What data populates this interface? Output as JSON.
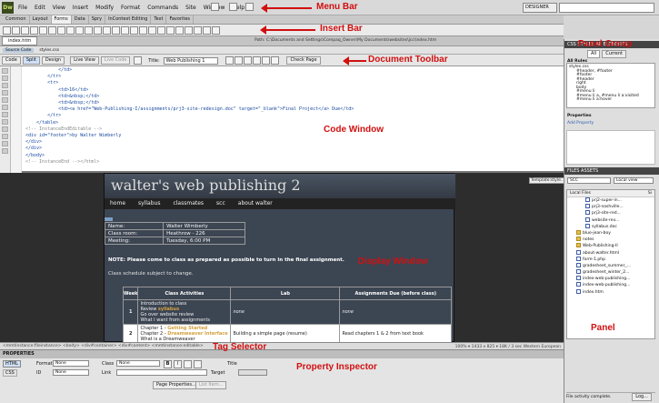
{
  "menubar": {
    "logo": "Dw",
    "items": [
      "File",
      "Edit",
      "View",
      "Insert",
      "Modify",
      "Format",
      "Commands",
      "Site",
      "Window",
      "Help"
    ],
    "workspace": "DESIGNER",
    "annotation": "Menu Bar"
  },
  "insert_bar": {
    "tabs": [
      "Common",
      "Layout",
      "Forms",
      "Data",
      "Spry",
      "InContext Editing",
      "Text",
      "Favorites"
    ],
    "active_tab": "Forms",
    "annotation": "Insert Bar"
  },
  "document": {
    "tab": "index.htm",
    "related_file": "styles.css",
    "path": "Path: C:\\Documents and Settings\\Compaq_Owner\\My Documents\\websites\\jcc\\index.htm",
    "source_code": "Source Code"
  },
  "doc_toolbar": {
    "code": "Code",
    "split": "Split",
    "design": "Design",
    "live_view": "Live View",
    "live_code": "Live Code",
    "title_label": "Title:",
    "title_value": "Web Publishing 1",
    "check_page": "Check Page",
    "annotation": "Document Toolbar"
  },
  "code_window": {
    "annotation": "Code Window",
    "lines": [
      "            </td>",
      "        </tr>",
      "        <tr>",
      "            <td>16</td>",
      "            <td>&nbsp;</td>",
      "            <td>&nbsp;</td>",
      "            <td><a href=\"Web-Publishing-I/assignments/prj3-site-redesign.doc\" target=\"_blank\">Final Project</a> Due</td>",
      "        </tr>",
      "    </table>",
      "<!-- InstanceEndEditable -->",
      "<div id=\"footer\">by Walter Wimberly",
      "</div>",
      "</div>",
      "</body>",
      "<!-- InstanceEnd --></html>"
    ]
  },
  "display_window": {
    "annotation": "Display Window",
    "site_title": "walter's web publishing 2",
    "nav": [
      "home",
      "syllabus",
      "classmates",
      "scc",
      "about walter"
    ],
    "info_rows": [
      [
        "Name:",
        "Walter Wimberly"
      ],
      [
        "Class room:",
        "Heathrow - 226"
      ],
      [
        "Meeting:",
        "Tuesday, 6:00 PM"
      ]
    ],
    "notice": "NOTE: Please come to class as prepared as possible to turn in the final assignment.",
    "subject": "Class schedule subject to change.",
    "schedule_headers": [
      "Week",
      "Class Activities",
      "Lab",
      "Assignments Due (before class)"
    ],
    "row1": {
      "week": "1",
      "activities_prefix": "Introduction to class",
      "review": "Review ",
      "review_link": "syllabus",
      "line3": "Go over website review",
      "line4": "What I want from assignments",
      "lab": "none",
      "due": "none"
    },
    "row2": {
      "week": "2",
      "ch1": "Chapter 1 - ",
      "ch1_link": "Getting Started",
      "ch2": "Chapter 2 - ",
      "ch2_link": "Dreamweaver Interface",
      "more": "What is a Dreamweaver",
      "lab": "Building a simple page (resume)",
      "due": "Read chapters 1 & 2 from text book"
    },
    "template_label": "Template:style..."
  },
  "tag_selector": {
    "annotation": "Tag Selector",
    "path": "<mmtinstance:fileinstance> <body> <div#container> <div#content> <mmtinstance:editable>",
    "status": "100% ▾  1433 x 825 ▾  18K / 3 sec  Western European"
  },
  "property_inspector": {
    "header": "PROPERTIES",
    "annotation": "Property Inspector",
    "html": "HTML",
    "css": "CSS",
    "format_label": "Format",
    "format_value": "None",
    "class_label": "Class",
    "class_value": "None",
    "id_label": "ID",
    "id_value": "None",
    "link_label": "Link",
    "title_label": "Title",
    "target_label": "Target",
    "page_props": "Page Properties...",
    "list_item": "List Item..."
  },
  "panel": {
    "annotation_group": "Panel Group",
    "annotation_panel": "Panel",
    "css_header": "CSS STYLES   AP ELEMENTS",
    "mode_all": "All",
    "mode_current": "Current",
    "all_rules": "All Rules",
    "rules": [
      "styles.css",
      "#header, #footer",
      "#footer",
      "#header",
      "right",
      "body",
      "#menu li",
      "#menu li a, #menu li a:visited",
      "#menu li a:hover"
    ],
    "properties": "Properties",
    "add_property": "Add Property",
    "files_header": "FILES   ASSETS",
    "site": "SCC",
    "view": "Local view",
    "local_files": "Local Files",
    "size_col": "Si",
    "file_rows": [
      "prj2-super-in...",
      "prj3-nashville...",
      "prj3-site-red...",
      "website-rev...",
      "syllabus.doc",
      "blue-jean-boy",
      "notes",
      "Web-Publishing-II",
      "about-walter.html",
      "form-1.php",
      "gradesheet_summer_...",
      "gradesheet_winter_2...",
      "index-web-publishing...",
      "index-web-publishing...",
      "index.htm"
    ],
    "status": "File activity complete.",
    "log": "Log..."
  }
}
